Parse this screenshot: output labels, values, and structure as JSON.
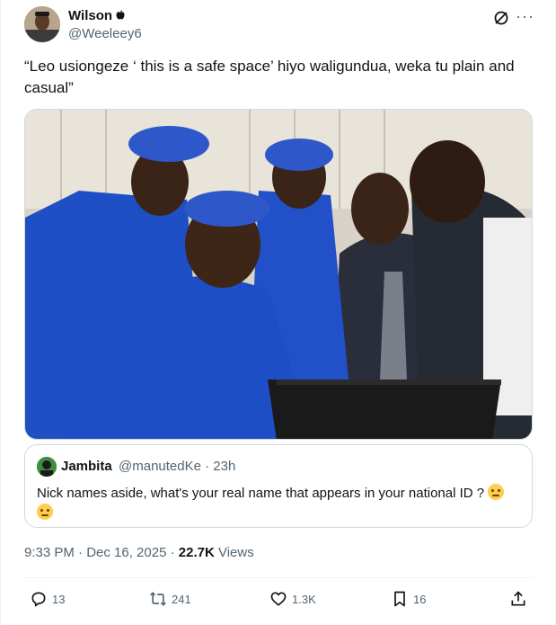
{
  "author": {
    "name": "Wilson",
    "handle": "@Weeleey6"
  },
  "tweet": {
    "text": "“Leo usiongeze ‘ this is a safe space’ hiyo waligundua, weka tu plain and casual”"
  },
  "quoted": {
    "name": "Jambita",
    "handle_time": "@manutedKe · 23h",
    "text": "Nick names aside, what's your real name that appears in your national ID ?"
  },
  "meta": {
    "time": "9:33 PM · Dec 16, 2025 · ",
    "views_count": "22.7K",
    "views_label": " Views"
  },
  "actions": {
    "replies": "13",
    "reposts": "241",
    "likes": "1.3K",
    "bookmarks": "16"
  },
  "colors": {
    "text": "#0f1419",
    "muted": "#536471",
    "border": "#cfd9de",
    "repost_green": "#00ba7c",
    "uniform_blue": "#1f4fc4"
  },
  "icons": [
    "grok-icon",
    "more-icon",
    "reply-icon",
    "repost-icon",
    "like-icon",
    "bookmark-icon",
    "share-icon",
    "thinking-face-emoji"
  ]
}
